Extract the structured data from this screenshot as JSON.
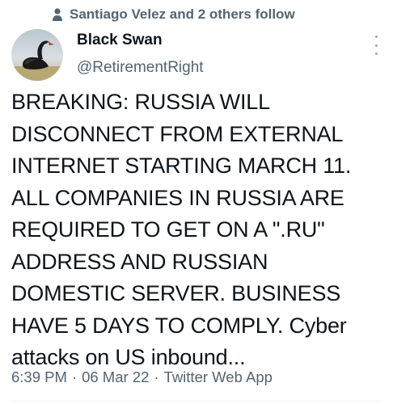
{
  "social_context": {
    "icon": "person-icon",
    "text": "Santiago Velez and 2 others follow"
  },
  "author": {
    "avatar": "black-swan-avatar",
    "name": "Black Swan",
    "handle": "@RetirementRight"
  },
  "tweet": {
    "text": "BREAKING: RUSSIA WILL\nDISCONNECT FROM EXTERNAL\nINTERNET STARTING MARCH 11.\nALL COMPANIES IN RUSSIA ARE\nREQUIRED TO GET ON A \".RU\"\nADDRESS AND RUSSIAN\nDOMESTIC SERVER. BUSINESS\nHAVE 5 DAYS TO COMPLY. Cyber\nattacks on US inbound...",
    "time": "6:39 PM",
    "sep1": "·",
    "date": "06 Mar 22",
    "sep2": "·",
    "source": "Twitter Web App"
  },
  "colors": {
    "text_primary": "#0f1419",
    "text_secondary": "#536471"
  }
}
